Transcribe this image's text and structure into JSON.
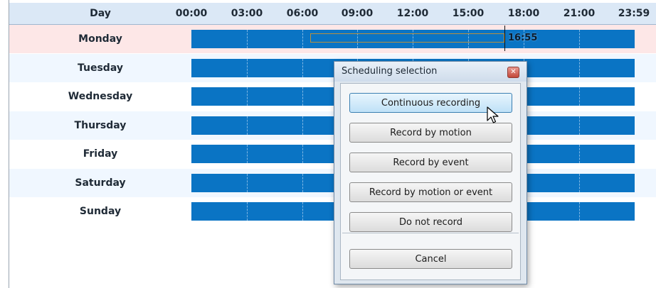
{
  "header": {
    "day_label": "Day",
    "times": [
      "00:00",
      "03:00",
      "06:00",
      "09:00",
      "12:00",
      "15:00",
      "18:00",
      "21:00",
      "23:59"
    ]
  },
  "days": [
    "Monday",
    "Tuesday",
    "Wednesday",
    "Thursday",
    "Friday",
    "Saturday",
    "Sunday"
  ],
  "selected_day": "Monday",
  "cursor_time": "16:55",
  "colors": {
    "bar": "#0a74c4",
    "header_bg": "#dbe8f6",
    "selected_row_bg": "#fde7e7"
  },
  "dialog": {
    "title": "Scheduling selection",
    "close_icon": "close-icon",
    "buttons": [
      "Continuous recording",
      "Record by motion",
      "Record by event",
      "Record by motion or event",
      "Do not record"
    ],
    "cancel_label": "Cancel"
  }
}
